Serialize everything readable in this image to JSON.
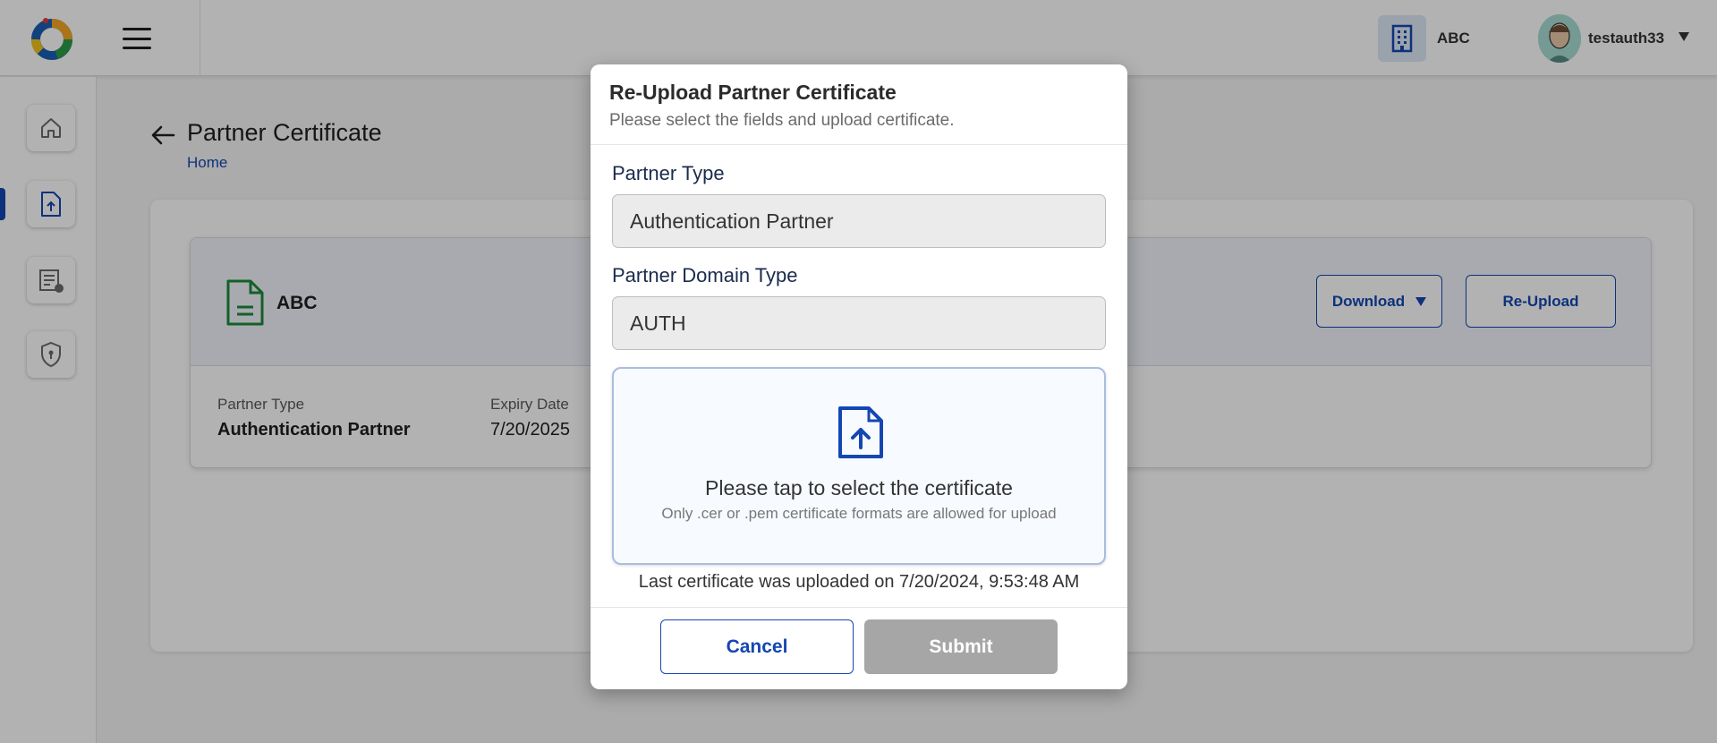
{
  "header": {
    "org_name": "ABC",
    "username": "testauth33",
    "icons": [
      "logo",
      "menu-icon",
      "building-icon",
      "avatar",
      "caret-down-icon"
    ]
  },
  "sidenav": {
    "items": [
      {
        "name": "home",
        "icon": "home-icon"
      },
      {
        "name": "certificates",
        "icon": "upload-file-icon",
        "active": true
      },
      {
        "name": "documents",
        "icon": "document-lock-icon"
      },
      {
        "name": "security",
        "icon": "shield-lock-icon"
      }
    ],
    "accent_color": "#1447b2"
  },
  "page": {
    "title": "Partner Certificate",
    "breadcrumb": "Home"
  },
  "cert_card": {
    "name": "ABC",
    "download_label": "Download",
    "reupload_label": "Re-Upload",
    "partner_type_label": "Partner Type",
    "partner_type_value": "Authentication Partner",
    "expiry_label": "Expiry Date",
    "expiry_value": "7/20/2025"
  },
  "modal": {
    "title": "Re-Upload Partner Certificate",
    "subtitle": "Please select the fields and upload certificate.",
    "partner_type_label": "Partner Type",
    "partner_type_value": "Authentication Partner",
    "domain_type_label": "Partner Domain Type",
    "domain_type_value": "AUTH",
    "upload_primary": "Please tap to select the certificate",
    "upload_secondary": "Only .cer or .pem certificate formats are allowed for upload",
    "last_uploaded": "Last certificate was uploaded on 7/20/2024, 9:53:48 AM",
    "cancel_label": "Cancel",
    "submit_label": "Submit"
  }
}
